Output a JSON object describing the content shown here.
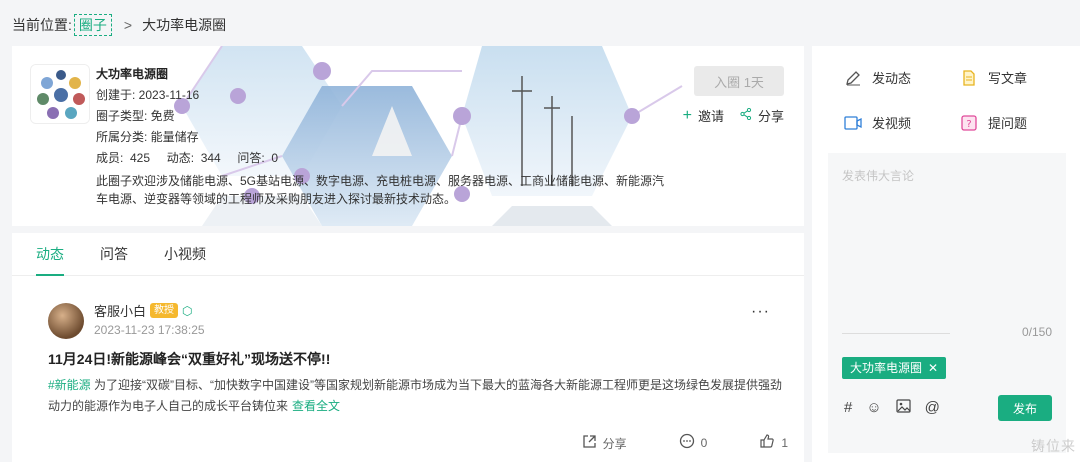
{
  "breadcrumb": {
    "prefix": "当前位置:",
    "link": "圈子",
    "sep": ">",
    "current": "大功率电源圈"
  },
  "circle": {
    "title": "大功率电源圈",
    "created": "创建于: 2023-11-16",
    "type": "圈子类型: 免费",
    "category": "所属分类: 能量储存",
    "stats": "成员:  425     动态:  344     问答:  0",
    "description": "此圈子欢迎涉及储能电源、5G基站电源、数字电源、充电桩电源、服务器电源、工商业储能电源、新能源汽车电源、逆变器等领域的工程师及采购朋友进入探讨最新技术动态。",
    "join_label": "入圈 1天",
    "invite_label": "邀请",
    "share_label": "分享"
  },
  "tabs": [
    "动态",
    "问答",
    "小视频"
  ],
  "post": {
    "author": "客服小白",
    "badge": "教授",
    "time": "2023-11-23 17:38:25",
    "title": "11月24日!新能源峰会“双重好礼”现场送不停!!",
    "tag": "#新能源",
    "body": " 为了迎接“双碳”目标、“加快数字中国建设”等国家规划新能源市场成为当下最大的蓝海各大新能源工程师更是这场绿色发展提供强劲动力的能源作为电子人自己的成长平台铸位来",
    "read_more": "查看全文",
    "share_label": "分享",
    "comments": "0",
    "likes": "1"
  },
  "sidebar": {
    "post_dynamic": "发动态",
    "write_article": "写文章",
    "post_video": "发视频",
    "ask_question": "提问题",
    "placeholder": "发表伟大言论",
    "counter": "0/150",
    "circle_tag": "大功率电源圈",
    "publish": "发布"
  },
  "watermark": "铸位来",
  "colors": {
    "accent": "#1aad81",
    "badge": "#f5b82e"
  }
}
